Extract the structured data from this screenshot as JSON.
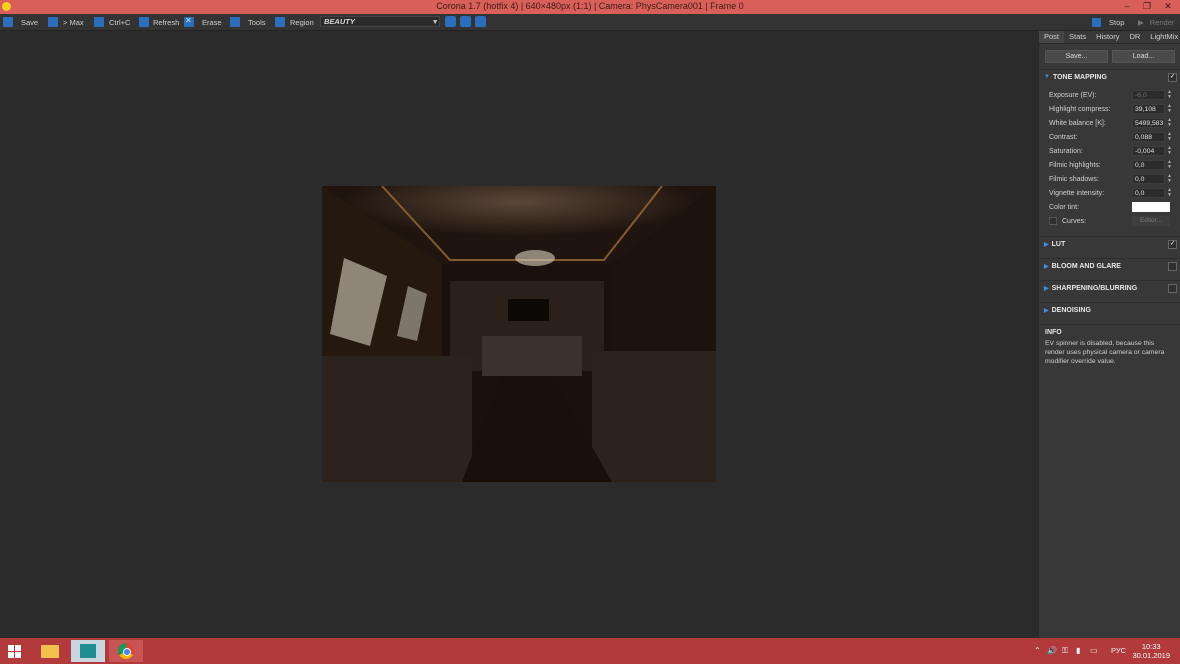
{
  "window": {
    "title": "Corona 1.7 (hotfix 4) | 640×480px (1:1) | Camera: PhysCamera001 | Frame 0"
  },
  "toolbar": {
    "save": "Save",
    "max": "> Max",
    "copy": "Ctrl+C",
    "refresh": "Refresh",
    "erase": "Erase",
    "tools": "Tools",
    "region": "Region",
    "pass": "BEAUTY",
    "stop": "Stop",
    "render": "Render"
  },
  "panel": {
    "tabs": [
      "Post",
      "Stats",
      "History",
      "DR",
      "LightMix"
    ],
    "save": "Save...",
    "load": "Load...",
    "tone_mapping": {
      "title": "TONE MAPPING",
      "exposure_label": "Exposure (EV):",
      "exposure_value": "-6,0",
      "highlight_label": "Highlight compress:",
      "highlight_value": "39,108",
      "wb_label": "White balance [K]:",
      "wb_value": "5499,583",
      "contrast_label": "Contrast:",
      "contrast_value": "0,088",
      "saturation_label": "Saturation:",
      "saturation_value": "-0,004",
      "fhigh_label": "Filmic highlights:",
      "fhigh_value": "0,0",
      "fshadow_label": "Filmic shadows:",
      "fshadow_value": "0,0",
      "vignette_label": "Vignette intensity:",
      "vignette_value": "0,0",
      "tint_label": "Color tint:",
      "curves_label": "Curves:",
      "editor": "Editor..."
    },
    "sections": {
      "lut": "LUT",
      "bloom": "BLOOM AND GLARE",
      "sharpen": "SHARPENING/BLURRING",
      "denoise": "DENOISING"
    },
    "info": {
      "title": "INFO",
      "text": "EV spinner is disabled, because this render uses physical camera or camera modifier override value."
    }
  },
  "taskbar": {
    "lang": "РУС",
    "time": "10:33",
    "date": "30.01.2019"
  },
  "colors": {
    "titlebar": "#d9605a",
    "taskbar": "#b23a3a",
    "accent": "#2a6fbd"
  }
}
